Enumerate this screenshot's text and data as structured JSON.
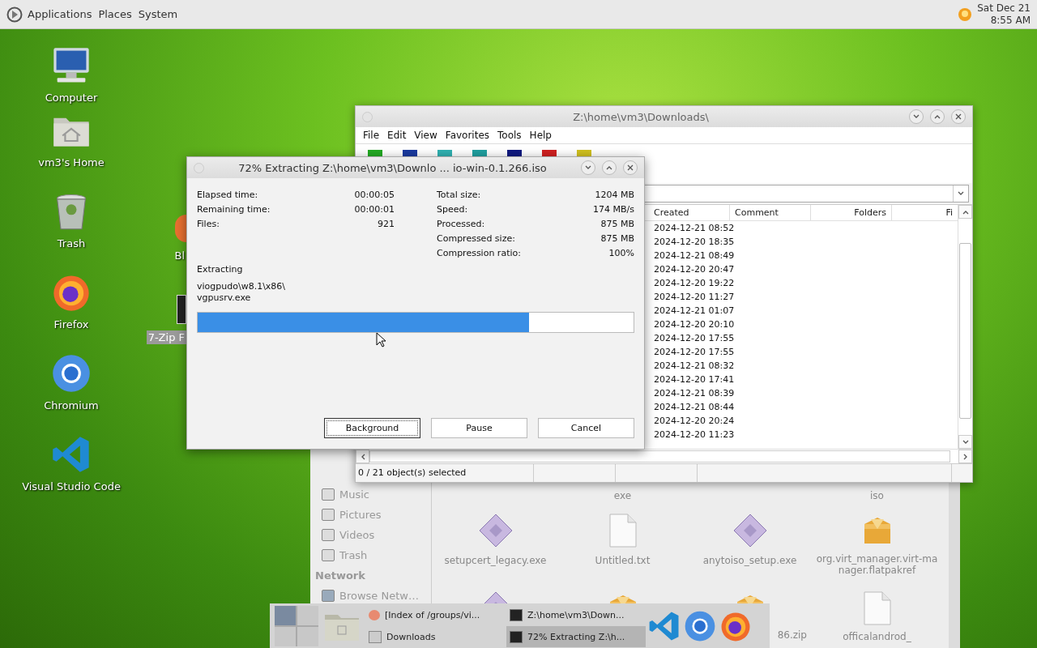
{
  "top_panel": {
    "menus": [
      "Applications",
      "Places",
      "System"
    ],
    "clock": {
      "date": "Sat Dec 21",
      "time": "8:55 AM"
    }
  },
  "desktop_icons": [
    {
      "label": "Computer",
      "kind": "computer"
    },
    {
      "label": "vm3's Home",
      "kind": "home"
    },
    {
      "label": "Trash",
      "kind": "trash"
    },
    {
      "label": "Firefox",
      "kind": "firefox"
    },
    {
      "label": "Chromium",
      "kind": "chromium"
    },
    {
      "label": "Visual Studio Code",
      "kind": "vscode"
    }
  ],
  "partial_icons": [
    {
      "label": "Bl",
      "kind": "orb",
      "selected": false
    },
    {
      "label": "7-Zip F",
      "kind": "archive",
      "selected": true
    }
  ],
  "file_manager": {
    "sidebar": [
      {
        "label": "Music",
        "kind": "item"
      },
      {
        "label": "Pictures",
        "kind": "item"
      },
      {
        "label": "Videos",
        "kind": "item"
      },
      {
        "label": "Trash",
        "kind": "item"
      },
      {
        "label": "Network",
        "kind": "heading"
      },
      {
        "label": "Browse Netw…",
        "kind": "network"
      }
    ],
    "cut_labels": [
      "exe",
      "iso"
    ],
    "files": [
      {
        "label": "setupcert_legacy.exe",
        "kind": "exe"
      },
      {
        "label": "Untitled.txt",
        "kind": "text"
      },
      {
        "label": "anytoiso_setup.exe",
        "kind": "exe"
      },
      {
        "label": "org.virt_manager.virt-manager.flatpakref",
        "kind": "package"
      },
      {
        "kind": "exe"
      },
      {
        "kind": "package"
      },
      {
        "label": "86.zip",
        "kind": "package"
      },
      {
        "label": "officalandrod_",
        "kind": "text"
      }
    ]
  },
  "archive_window": {
    "title": "Z:\\home\\vm3\\Downloads\\",
    "menu": [
      "File",
      "Edit",
      "View",
      "Favorites",
      "Tools",
      "Help"
    ],
    "columns": [
      "Created",
      "Comment",
      "Folders",
      "Fi"
    ],
    "rows": [
      "2024-12-21 08:52",
      "2024-12-20 18:35",
      "2024-12-21 08:49",
      "2024-12-20 20:47",
      "2024-12-20 19:22",
      "2024-12-20 11:27",
      "2024-12-21 01:07",
      "2024-12-20 20:10",
      "2024-12-20 17:55",
      "2024-12-20 17:55",
      "2024-12-21 08:32",
      "2024-12-20 17:41",
      "2024-12-21 08:39",
      "2024-12-21 08:44",
      "2024-12-20 20:24",
      "2024-12-20 11:23"
    ],
    "status": "0 / 21 object(s) selected"
  },
  "progress_dialog": {
    "title": "72% Extracting Z:\\home\\vm3\\Downlo ... io-win-0.1.266.iso",
    "left_stats": [
      {
        "label": "Elapsed time:",
        "value": "00:00:05"
      },
      {
        "label": "Remaining time:",
        "value": "00:00:01"
      },
      {
        "label": "Files:",
        "value": "921"
      }
    ],
    "right_stats": [
      {
        "label": "Total size:",
        "value": "1204 MB"
      },
      {
        "label": "Speed:",
        "value": "174 MB/s"
      },
      {
        "label": "Processed:",
        "value": "875 MB"
      },
      {
        "label": "Compressed size:",
        "value": "875 MB"
      },
      {
        "label": "Compression ratio:",
        "value": "100%"
      }
    ],
    "operation": "Extracting",
    "current_path": "viogpudo\\w8.1\\x86\\",
    "current_file": "vgpusrv.exe",
    "level": 0.76,
    "buttons": [
      {
        "label": "Background",
        "focused": true
      },
      {
        "label": "Pause",
        "focused": false
      },
      {
        "label": "Cancel",
        "focused": false
      }
    ]
  },
  "taskbar": {
    "tasks": [
      {
        "label": "[Index of /groups/vi...",
        "kind": "browser",
        "selected": false
      },
      {
        "label": "Downloads",
        "kind": "folder",
        "selected": false
      },
      {
        "label": "Z:\\home\\vm3\\Down...",
        "kind": "archive",
        "selected": false
      },
      {
        "label": "72% Extracting Z:\\h...",
        "kind": "archive",
        "selected": true
      }
    ],
    "launchers": [
      {
        "kind": "vscode"
      },
      {
        "kind": "chromium"
      },
      {
        "kind": "firefox"
      }
    ]
  }
}
